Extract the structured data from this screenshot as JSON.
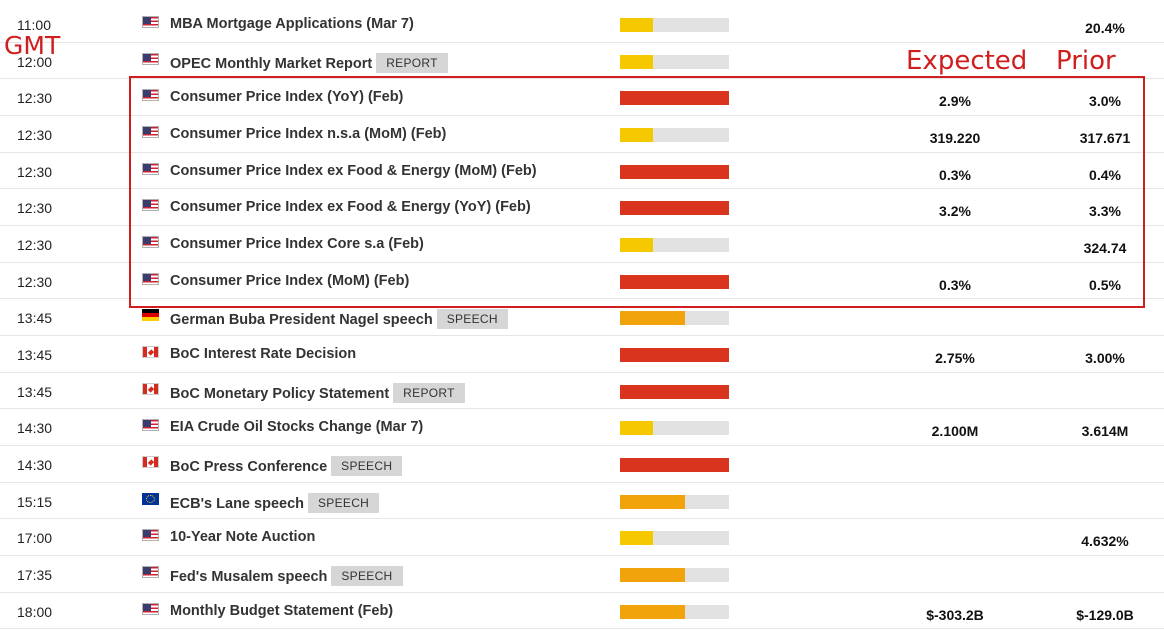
{
  "annotations": {
    "gmt": "GMT",
    "expected": "Expected",
    "prior": "Prior"
  },
  "colors": {
    "high_impact": "#d9341e",
    "medium_impact": "#f0a30a",
    "low_impact": "#f5c800",
    "annotation_red": "#d01e1e"
  },
  "events": [
    {
      "time": "11:00",
      "flag": "us",
      "flag_icon": "us-flag-icon",
      "name": "MBA Mortgage Applications (Mar 7)",
      "tag": "",
      "impact": "low",
      "impact_level": 0.3,
      "expected": "",
      "prior": "20.4%"
    },
    {
      "time": "12:00",
      "flag": "us",
      "flag_icon": "us-flag-icon",
      "name": "OPEC Monthly Market Report",
      "tag": "REPORT",
      "impact": "low",
      "impact_level": 0.3,
      "expected": "",
      "prior": ""
    },
    {
      "time": "12:30",
      "flag": "us",
      "flag_icon": "us-flag-icon",
      "name": "Consumer Price Index (YoY) (Feb)",
      "tag": "",
      "impact": "high",
      "impact_level": 1.0,
      "expected": "2.9%",
      "prior": "3.0%"
    },
    {
      "time": "12:30",
      "flag": "us",
      "flag_icon": "us-flag-icon",
      "name": "Consumer Price Index n.s.a (MoM) (Feb)",
      "tag": "",
      "impact": "low",
      "impact_level": 0.3,
      "expected": "319.220",
      "prior": "317.671"
    },
    {
      "time": "12:30",
      "flag": "us",
      "flag_icon": "us-flag-icon",
      "name": "Consumer Price Index ex Food & Energy (MoM) (Feb)",
      "tag": "",
      "impact": "high",
      "impact_level": 1.0,
      "expected": "0.3%",
      "prior": "0.4%"
    },
    {
      "time": "12:30",
      "flag": "us",
      "flag_icon": "us-flag-icon",
      "name": "Consumer Price Index ex Food & Energy (YoY) (Feb)",
      "tag": "",
      "impact": "high",
      "impact_level": 1.0,
      "expected": "3.2%",
      "prior": "3.3%"
    },
    {
      "time": "12:30",
      "flag": "us",
      "flag_icon": "us-flag-icon",
      "name": "Consumer Price Index Core s.a (Feb)",
      "tag": "",
      "impact": "low",
      "impact_level": 0.3,
      "expected": "",
      "prior": "324.74"
    },
    {
      "time": "12:30",
      "flag": "us",
      "flag_icon": "us-flag-icon",
      "name": "Consumer Price Index (MoM) (Feb)",
      "tag": "",
      "impact": "high",
      "impact_level": 1.0,
      "expected": "0.3%",
      "prior": "0.5%"
    },
    {
      "time": "13:45",
      "flag": "de",
      "flag_icon": "germany-flag-icon",
      "name": "German Buba President Nagel speech",
      "tag": "SPEECH",
      "impact": "medium",
      "impact_level": 0.6,
      "expected": "",
      "prior": ""
    },
    {
      "time": "13:45",
      "flag": "ca",
      "flag_icon": "canada-flag-icon",
      "name": "BoC Interest Rate Decision",
      "tag": "",
      "impact": "high",
      "impact_level": 1.0,
      "expected": "2.75%",
      "prior": "3.00%"
    },
    {
      "time": "13:45",
      "flag": "ca",
      "flag_icon": "canada-flag-icon",
      "name": "BoC Monetary Policy Statement",
      "tag": "REPORT",
      "impact": "high",
      "impact_level": 1.0,
      "expected": "",
      "prior": ""
    },
    {
      "time": "14:30",
      "flag": "us",
      "flag_icon": "us-flag-icon",
      "name": "EIA Crude Oil Stocks Change (Mar 7)",
      "tag": "",
      "impact": "low",
      "impact_level": 0.3,
      "expected": "2.100M",
      "prior": "3.614M"
    },
    {
      "time": "14:30",
      "flag": "ca",
      "flag_icon": "canada-flag-icon",
      "name": "BoC Press Conference",
      "tag": "SPEECH",
      "impact": "high",
      "impact_level": 1.0,
      "expected": "",
      "prior": ""
    },
    {
      "time": "15:15",
      "flag": "eu",
      "flag_icon": "eu-flag-icon",
      "name": "ECB's Lane speech",
      "tag": "SPEECH",
      "impact": "medium",
      "impact_level": 0.6,
      "expected": "",
      "prior": ""
    },
    {
      "time": "17:00",
      "flag": "us",
      "flag_icon": "us-flag-icon",
      "name": "10-Year Note Auction",
      "tag": "",
      "impact": "low",
      "impact_level": 0.3,
      "expected": "",
      "prior": "4.632%"
    },
    {
      "time": "17:35",
      "flag": "us",
      "flag_icon": "us-flag-icon",
      "name": "Fed's Musalem speech",
      "tag": "SPEECH",
      "impact": "medium",
      "impact_level": 0.6,
      "expected": "",
      "prior": ""
    },
    {
      "time": "18:00",
      "flag": "us",
      "flag_icon": "us-flag-icon",
      "name": "Monthly Budget Statement (Feb)",
      "tag": "",
      "impact": "medium",
      "impact_level": 0.6,
      "expected": "$-303.2B",
      "prior": "$-129.0B"
    }
  ]
}
